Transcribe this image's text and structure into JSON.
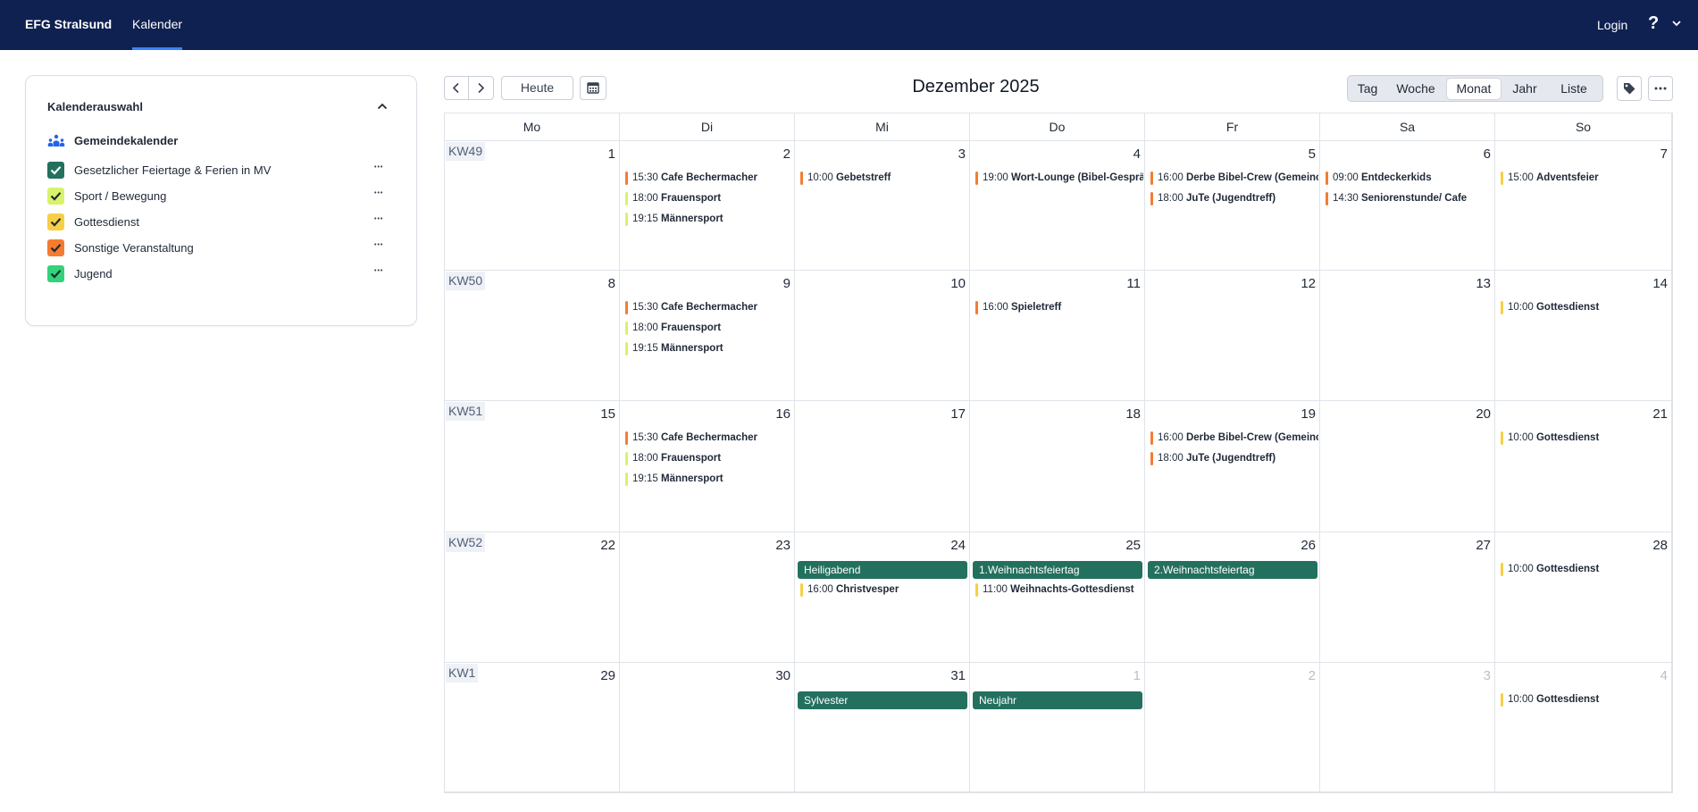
{
  "header": {
    "brand": "EFG Stralsund",
    "nav_tab": "Kalender",
    "login": "Login",
    "help": "?"
  },
  "sidebar": {
    "title": "Kalenderauswahl",
    "group_label": "Gemeindekalender",
    "items": [
      {
        "label": "Gesetzlicher Feiertage & Ferien in MV",
        "color": "#24705f"
      },
      {
        "label": "Sport / Bewegung",
        "color": "#d9f26b"
      },
      {
        "label": "Gottesdienst",
        "color": "#f7cf46"
      },
      {
        "label": "Sonstige Veranstaltung",
        "color": "#f47c32"
      },
      {
        "label": "Jugend",
        "color": "#34d27a"
      }
    ]
  },
  "toolbar": {
    "today": "Heute",
    "title": "Dezember 2025",
    "views": [
      "Tag",
      "Woche",
      "Monat",
      "Jahr",
      "Liste"
    ],
    "active_view": "Monat"
  },
  "weekdays": [
    "Mo",
    "Di",
    "Mi",
    "Do",
    "Fr",
    "Sa",
    "So"
  ],
  "colors": {
    "sport": "#d9f26b",
    "gottesdienst": "#f7cf46",
    "sonstige": "#f47c32",
    "feiertag": "#24705f"
  },
  "weeks": [
    {
      "kw": "KW49",
      "days": [
        {
          "num": "1",
          "events": []
        },
        {
          "num": "2",
          "events": [
            {
              "time": "15:30",
              "name": "Cafe Bechermacher",
              "cat": "sonstige"
            },
            {
              "time": "18:00",
              "name": "Frauensport",
              "cat": "sport"
            },
            {
              "time": "19:15",
              "name": "Männersport",
              "cat": "sport"
            }
          ]
        },
        {
          "num": "3",
          "events": [
            {
              "time": "10:00",
              "name": "Gebetstreff",
              "cat": "sonstige"
            }
          ]
        },
        {
          "num": "4",
          "events": [
            {
              "time": "19:00",
              "name": "Wort-Lounge (Bibel-Gesprä",
              "cat": "sonstige"
            }
          ]
        },
        {
          "num": "5",
          "events": [
            {
              "time": "16:00",
              "name": "Derbe Bibel-Crew (Gemeinc",
              "cat": "sonstige"
            },
            {
              "time": "18:00",
              "name": "JuTe (Jugendtreff)",
              "cat": "sonstige"
            }
          ]
        },
        {
          "num": "6",
          "events": [
            {
              "time": "09:00",
              "name": "Entdeckerkids",
              "cat": "sonstige"
            },
            {
              "time": "14:30",
              "name": "Seniorenstunde/ Cafe",
              "cat": "sonstige"
            }
          ]
        },
        {
          "num": "7",
          "events": [
            {
              "time": "15:00",
              "name": "Adventsfeier",
              "cat": "gottesdienst"
            }
          ]
        }
      ]
    },
    {
      "kw": "KW50",
      "days": [
        {
          "num": "8",
          "events": []
        },
        {
          "num": "9",
          "events": [
            {
              "time": "15:30",
              "name": "Cafe Bechermacher",
              "cat": "sonstige"
            },
            {
              "time": "18:00",
              "name": "Frauensport",
              "cat": "sport"
            },
            {
              "time": "19:15",
              "name": "Männersport",
              "cat": "sport"
            }
          ]
        },
        {
          "num": "10",
          "events": []
        },
        {
          "num": "11",
          "events": [
            {
              "time": "16:00",
              "name": "Spieletreff",
              "cat": "sonstige"
            }
          ]
        },
        {
          "num": "12",
          "events": []
        },
        {
          "num": "13",
          "events": []
        },
        {
          "num": "14",
          "events": [
            {
              "time": "10:00",
              "name": "Gottesdienst",
              "cat": "gottesdienst"
            }
          ]
        }
      ]
    },
    {
      "kw": "KW51",
      "days": [
        {
          "num": "15",
          "events": []
        },
        {
          "num": "16",
          "events": [
            {
              "time": "15:30",
              "name": "Cafe Bechermacher",
              "cat": "sonstige"
            },
            {
              "time": "18:00",
              "name": "Frauensport",
              "cat": "sport"
            },
            {
              "time": "19:15",
              "name": "Männersport",
              "cat": "sport"
            }
          ]
        },
        {
          "num": "17",
          "events": []
        },
        {
          "num": "18",
          "events": []
        },
        {
          "num": "19",
          "events": [
            {
              "time": "16:00",
              "name": "Derbe Bibel-Crew (Gemeinc",
              "cat": "sonstige"
            },
            {
              "time": "18:00",
              "name": "JuTe (Jugendtreff)",
              "cat": "sonstige"
            }
          ]
        },
        {
          "num": "20",
          "events": []
        },
        {
          "num": "21",
          "events": [
            {
              "time": "10:00",
              "name": "Gottesdienst",
              "cat": "gottesdienst"
            }
          ]
        }
      ]
    },
    {
      "kw": "KW52",
      "days": [
        {
          "num": "22",
          "events": []
        },
        {
          "num": "23",
          "events": []
        },
        {
          "num": "24",
          "allday": "Heiligabend",
          "events": [
            {
              "time": "16:00",
              "name": "Christvesper",
              "cat": "gottesdienst"
            }
          ]
        },
        {
          "num": "25",
          "allday": "1.Weihnachtsfeiertag",
          "events": [
            {
              "time": "11:00",
              "name": "Weihnachts-Gottesdienst",
              "cat": "gottesdienst"
            }
          ]
        },
        {
          "num": "26",
          "allday": "2.Weihnachtsfeiertag",
          "events": []
        },
        {
          "num": "27",
          "events": []
        },
        {
          "num": "28",
          "events": [
            {
              "time": "10:00",
              "name": "Gottesdienst",
              "cat": "gottesdienst"
            }
          ]
        }
      ]
    },
    {
      "kw": "KW1",
      "days": [
        {
          "num": "29",
          "events": []
        },
        {
          "num": "30",
          "events": []
        },
        {
          "num": "31",
          "allday": "Sylvester",
          "events": []
        },
        {
          "num": "1",
          "other": true,
          "allday": "Neujahr",
          "events": []
        },
        {
          "num": "2",
          "other": true,
          "events": []
        },
        {
          "num": "3",
          "other": true,
          "events": []
        },
        {
          "num": "4",
          "other": true,
          "events": [
            {
              "time": "10:00",
              "name": "Gottesdienst",
              "cat": "gottesdienst"
            }
          ]
        }
      ]
    }
  ]
}
